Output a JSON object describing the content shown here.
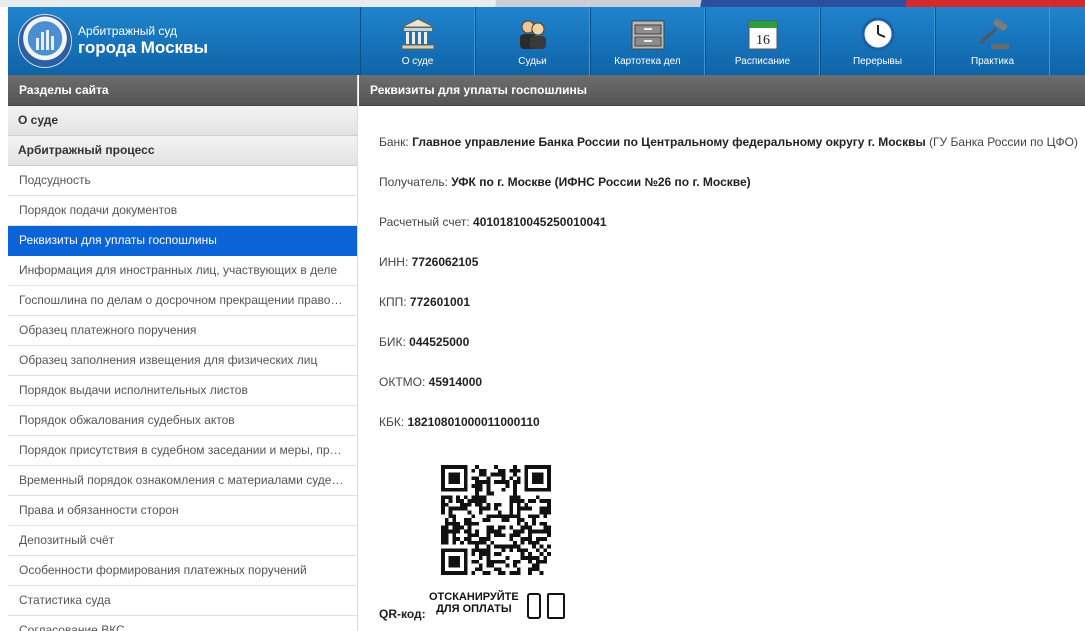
{
  "header": {
    "court_line1": "Арбитражный суд",
    "court_line2": "города Москвы",
    "brand_color": "#1778c0",
    "nav": [
      {
        "label": "О суде",
        "icon": "courthouse-icon"
      },
      {
        "label": "Судьи",
        "icon": "judges-icon"
      },
      {
        "label": "Картотека дел",
        "icon": "file-cabinet-icon"
      },
      {
        "label": "Расписание",
        "icon": "calendar-icon",
        "day": "16"
      },
      {
        "label": "Перерывы",
        "icon": "clock-icon"
      },
      {
        "label": "Практика",
        "icon": "gavel-icon"
      }
    ]
  },
  "sidebar": {
    "title": "Разделы сайта",
    "sections": [
      "О суде",
      "Арбитражный процесс"
    ],
    "items": [
      "Подсудность",
      "Порядок подачи документов",
      "Реквизиты для уплаты госпошлины",
      "Информация для иностранных лиц, участвующих в деле",
      "Госпошлина по делам о досрочном прекращении правомочий",
      "Образец платежного поручения",
      "Образец заполнения извещения для физических лиц",
      "Порядок выдачи исполнительных листов",
      "Порядок обжалования судебных актов",
      "Порядок присутствия в судебном заседании и меры, принимаемые",
      "Временный порядок ознакомления с материалами судебных дел",
      "Права и обязанности сторон",
      "Депозитный счёт",
      "Особенности формирования платежных поручений",
      "Статистика суда",
      "Согласование ВКС"
    ],
    "active_index": 2,
    "active_color": "#0b63d8"
  },
  "main": {
    "title": "Реквизиты для уплаты госпошлины",
    "bank_label": "Банк:",
    "bank_name": "Главное управление Банка России по Центральному федеральному округу г. Москвы",
    "bank_short": "(ГУ Банка России по ЦФО)",
    "recipient_label": "Получатель:",
    "recipient_value": "УФК по г. Москве (ИФНС России №26 по г. Москве)",
    "account_label": "Расчетный счет:",
    "account_value": "40101810045250010041",
    "inn_label": "ИНН:",
    "inn_value": "7726062105",
    "kpp_label": "КПП:",
    "kpp_value": "772601001",
    "bik_label": "БИК:",
    "bik_value": "044525000",
    "oktmo_label": "ОКТМО:",
    "oktmo_value": "45914000",
    "kbk_label": "КБК:",
    "kbk_value": "18210801000011000110",
    "qr_label": "QR-код:",
    "qr_scan_line1": "ОТСКАНИРУЙТЕ",
    "qr_scan_line2": "ДЛЯ ОПЛАТЫ"
  }
}
